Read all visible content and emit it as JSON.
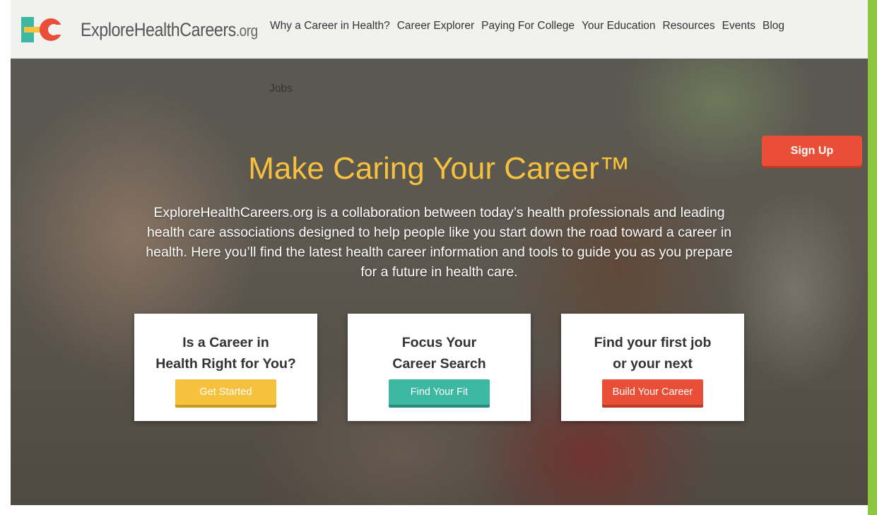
{
  "logo": {
    "name": "ExploreHealthCareers",
    "tld": ".org"
  },
  "nav": {
    "items": [
      "Why a Career in Health?",
      "Career Explorer",
      "Paying For College",
      "Your Education",
      "Resources",
      "Events",
      "Blog"
    ],
    "overflow_item": "Jobs"
  },
  "hero": {
    "signup_label": "Sign Up",
    "title": "Make Caring Your Career™",
    "text": "ExploreHealthCareers.org is a collaboration between today’s health professionals and leading health care associations designed to help people like you start down the road toward a career in health. Here you’ll find the latest health career information and tools to guide you as you prepare for a future in health care."
  },
  "cards": [
    {
      "line1": "Is a Career in",
      "line2": "Health Right for You?",
      "button": "Get Started",
      "color": "#f6c23e"
    },
    {
      "line1": "Focus Your",
      "line2": "Career Search",
      "button": "Find Your Fit",
      "color": "#3cb8a3"
    },
    {
      "line1": "Find your first job",
      "line2": "or your next",
      "button": "Build Your Career",
      "color": "#e94f37"
    }
  ],
  "colors": {
    "brand_yellow": "#f6c23e",
    "brand_teal": "#3cb8a3",
    "brand_red": "#e94f37",
    "slide_green": "#8cc63f"
  }
}
